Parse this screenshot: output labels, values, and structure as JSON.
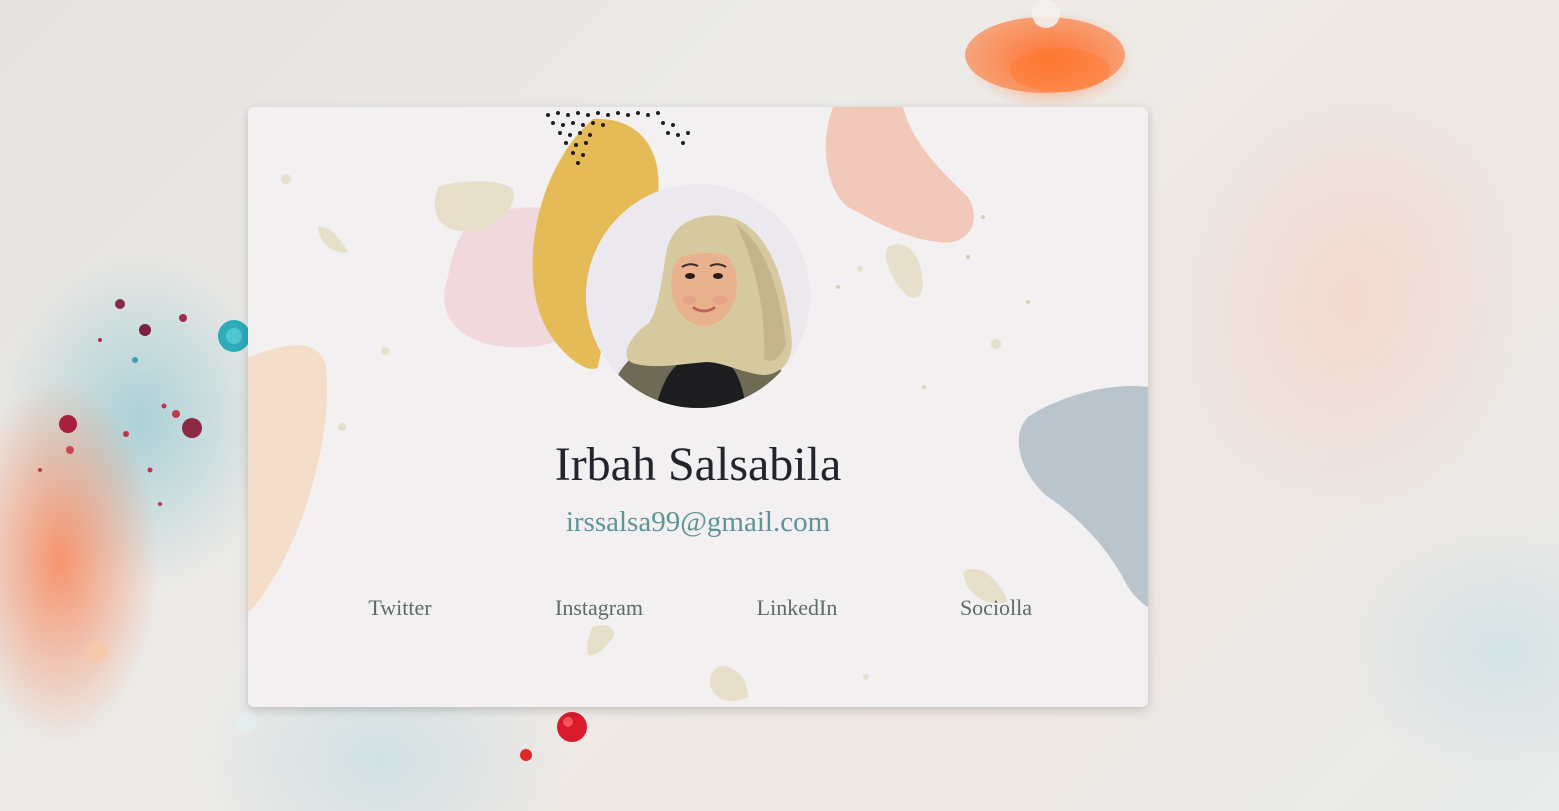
{
  "profile": {
    "name": "Irbah Salsabila",
    "email": "irssalsa99@gmail.com",
    "avatar_alt": "profile-photo"
  },
  "links": [
    {
      "label": "Twitter"
    },
    {
      "label": "Instagram"
    },
    {
      "label": "LinkedIn"
    },
    {
      "label": "Sociolla"
    }
  ],
  "colors": {
    "card_background": "#f3f0f1",
    "name_text": "#23252c",
    "email_text": "#5f9494",
    "link_text": "#5d6b6b"
  }
}
